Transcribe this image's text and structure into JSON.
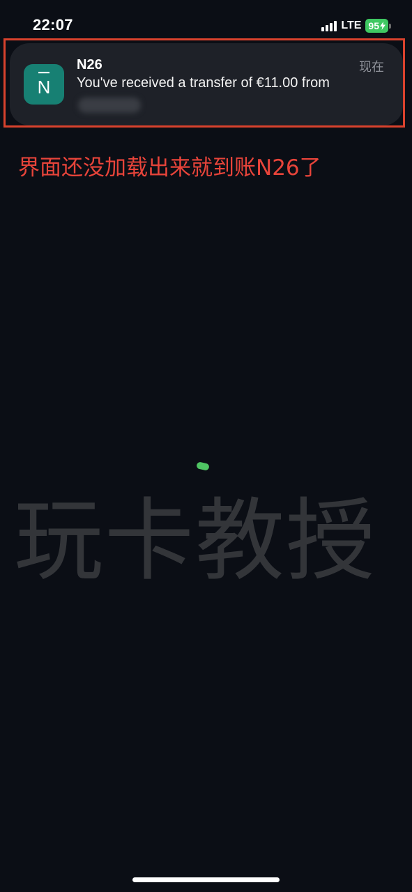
{
  "status_bar": {
    "time": "22:07",
    "network": "LTE",
    "battery": "95"
  },
  "notification": {
    "app_name": "N26",
    "time": "现在",
    "body": "You've received a transfer of €11.00 from",
    "app_icon_glyph": "N",
    "app_icon_color": "#178073"
  },
  "annotation": {
    "text": "界面还没加载出来就到账N26了",
    "color": "#e8443a"
  },
  "watermark": {
    "text": "玩卡教授"
  },
  "colors": {
    "background": "#0b0e15",
    "card": "#1e2128",
    "highlight": "#d9422d",
    "battery": "#3fc862"
  }
}
